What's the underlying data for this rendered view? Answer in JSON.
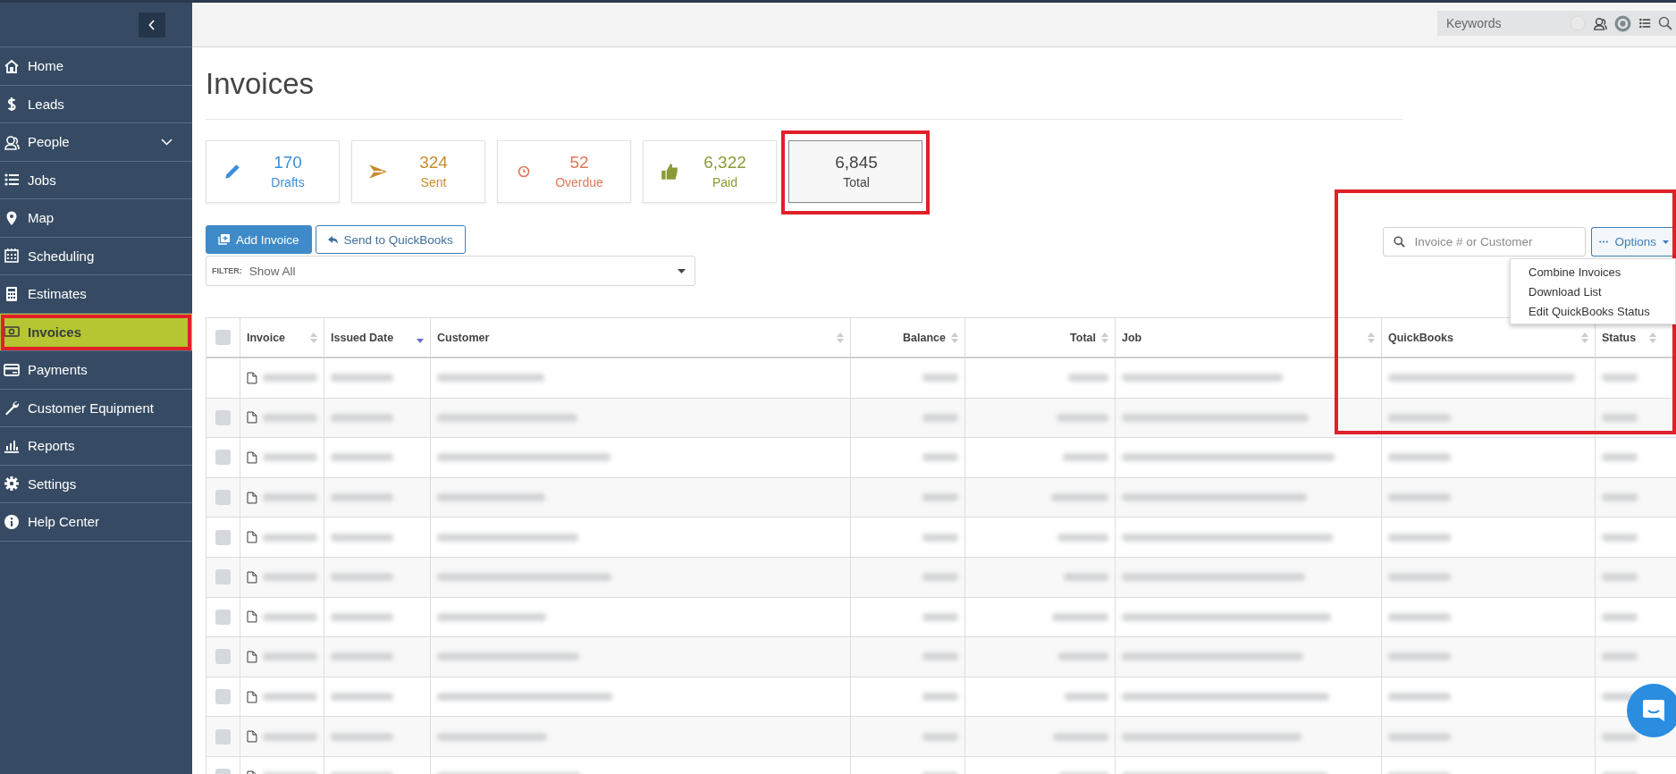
{
  "header": {
    "search": {
      "placeholder": "Keywords"
    }
  },
  "sidebar": {
    "items": [
      {
        "label": "Home",
        "selected": false,
        "highlighted": false
      },
      {
        "label": "Leads",
        "selected": false,
        "highlighted": false
      },
      {
        "label": "People",
        "selected": false,
        "highlighted": false,
        "expandable": true
      },
      {
        "label": "Jobs",
        "selected": false,
        "highlighted": false
      },
      {
        "label": "Map",
        "selected": false,
        "highlighted": false
      },
      {
        "label": "Scheduling",
        "selected": false,
        "highlighted": false
      },
      {
        "label": "Estimates",
        "selected": false,
        "highlighted": false
      },
      {
        "label": "Invoices",
        "selected": true,
        "highlighted": true
      },
      {
        "label": "Payments",
        "selected": false,
        "highlighted": false
      },
      {
        "label": "Customer Equipment",
        "selected": false,
        "highlighted": false
      },
      {
        "label": "Reports",
        "selected": false,
        "highlighted": false
      },
      {
        "label": "Settings",
        "selected": false,
        "highlighted": false
      },
      {
        "label": "Help Center",
        "selected": false,
        "highlighted": false
      }
    ]
  },
  "page_title": "Invoices",
  "stats": [
    {
      "kind": "pencil",
      "value": "170",
      "label": "Drafts",
      "color": "#3a8fd9",
      "selected": false,
      "highlighted": false
    },
    {
      "kind": "send",
      "value": "324",
      "label": "Sent",
      "color": "#c98a2c",
      "selected": false,
      "highlighted": false
    },
    {
      "kind": "clock",
      "value": "52",
      "label": "Overdue",
      "color": "#e0775a",
      "selected": false,
      "highlighted": false
    },
    {
      "kind": "thumb",
      "value": "6,322",
      "label": "Paid",
      "color": "#8a9a36",
      "selected": false,
      "highlighted": false
    },
    {
      "kind": "plain",
      "value": "6,845",
      "label": "Total",
      "color": "#444444",
      "selected": true,
      "highlighted": true
    }
  ],
  "buttons": [
    {
      "kind": "primary",
      "label": "Add Invoice"
    },
    {
      "kind": "outline",
      "label": "Send to QuickBooks"
    }
  ],
  "filter": {
    "label": "FILTER:",
    "value": "Show All"
  },
  "search": {
    "placeholder": "Invoice # or Customer"
  },
  "options": {
    "label": "Options",
    "expanded": true,
    "highlighted": true,
    "items": [
      "Combine Invoices",
      "Download List",
      "Edit QuickBooks Status"
    ]
  },
  "table": {
    "all_checked": false,
    "columns": [
      {
        "label": "Invoice",
        "kind": "text",
        "sorted": false
      },
      {
        "label": "Issued Date",
        "kind": "text",
        "sorted": true
      },
      {
        "label": "Customer",
        "kind": "text",
        "sorted": false
      },
      {
        "label": "Balance",
        "kind": "amount",
        "sorted": false
      },
      {
        "label": "Total",
        "kind": "amount",
        "sorted": false
      },
      {
        "label": "Job",
        "kind": "text",
        "sorted": false
      },
      {
        "label": "QuickBooks",
        "kind": "text",
        "sorted": false
      },
      {
        "label": "Status",
        "kind": "text",
        "sorted": false
      }
    ],
    "rows": [
      {
        "selectable": false
      },
      {
        "selectable": true
      },
      {
        "selectable": true
      },
      {
        "selectable": true
      },
      {
        "selectable": true
      },
      {
        "selectable": true
      },
      {
        "selectable": true
      },
      {
        "selectable": true
      },
      {
        "selectable": true
      },
      {
        "selectable": true
      },
      {
        "selectable": true
      }
    ]
  }
}
